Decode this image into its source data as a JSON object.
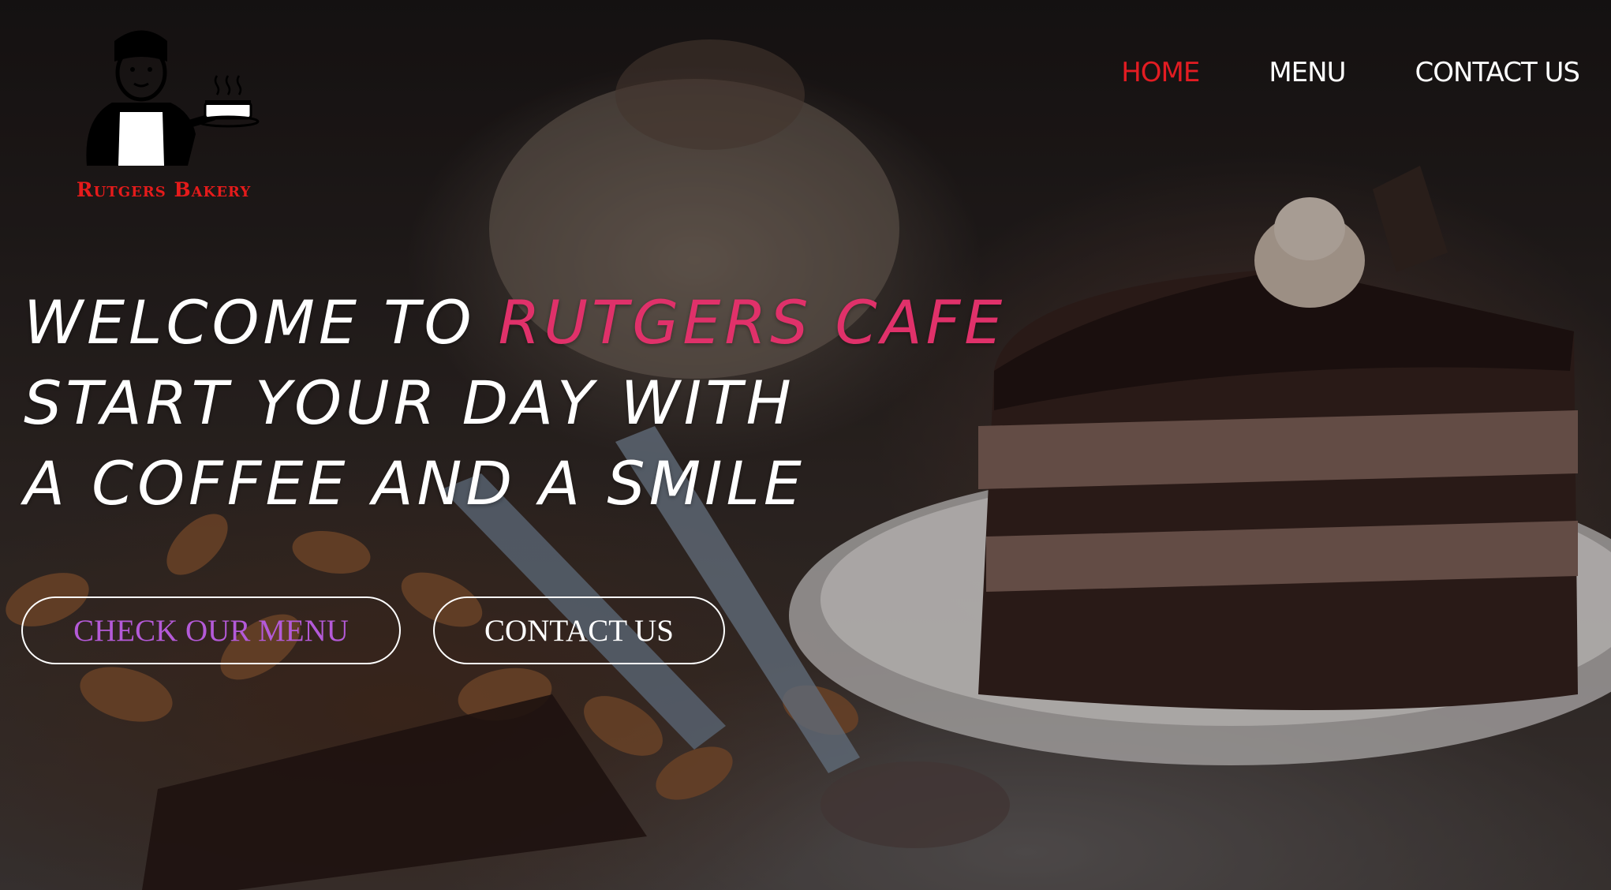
{
  "brand": {
    "logo_text": "Rutgers Bakery",
    "logo_color": "#e51b1b"
  },
  "nav": {
    "items": [
      {
        "label": "HOME",
        "active": true
      },
      {
        "label": "MENU",
        "active": false
      },
      {
        "label": "CONTACT US",
        "active": false
      }
    ],
    "active_color": "#e31c22"
  },
  "hero": {
    "line1_prefix": "WELCOME TO",
    "line1_accent": "RUTGERS CAFE",
    "line2": "START YOUR DAY WITH",
    "line3": "A COFFEE AND A SMILE",
    "accent_color": "#e0316a"
  },
  "buttons": {
    "menu_label": "CHECK OUR MENU",
    "contact_label": "CONTACT US"
  },
  "icons": [
    "chef-logo-icon",
    "cake-icon"
  ]
}
